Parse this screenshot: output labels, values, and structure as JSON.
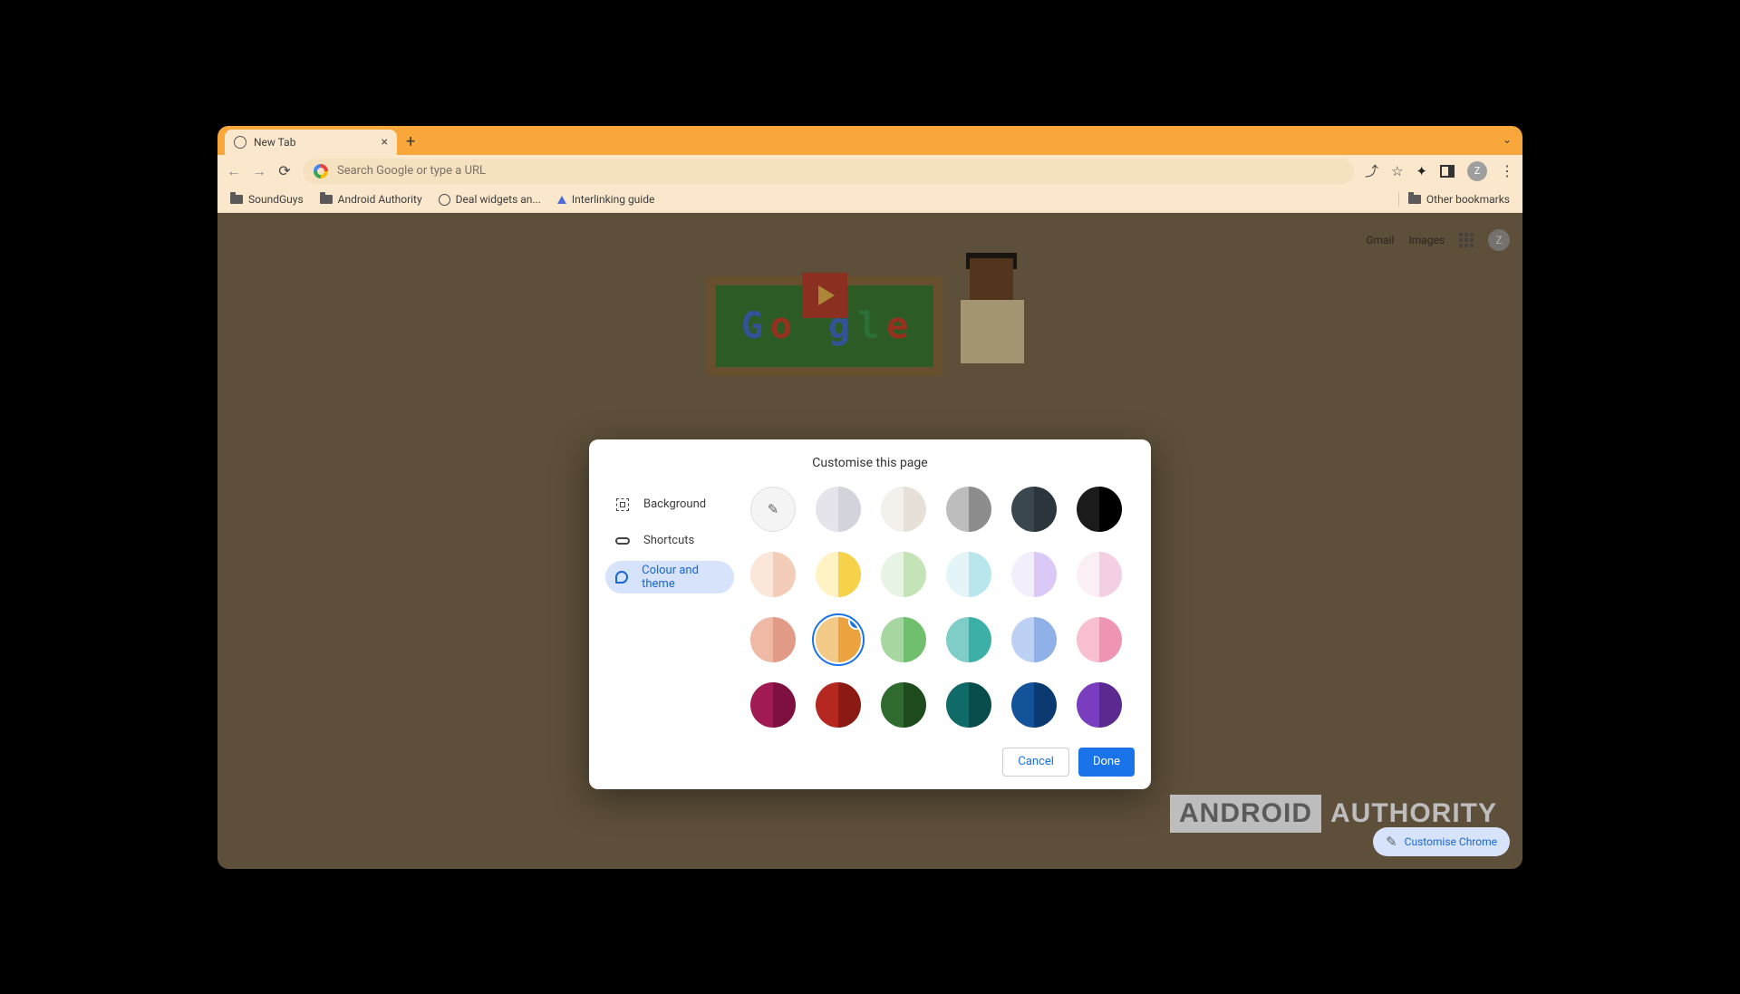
{
  "tab": {
    "title": "New Tab"
  },
  "omnibox": {
    "placeholder": "Search Google or type a URL"
  },
  "bookmarks": [
    {
      "label": "SoundGuys",
      "icon": "folder"
    },
    {
      "label": "Android Authority",
      "icon": "folder"
    },
    {
      "label": "Deal widgets an...",
      "icon": "globe"
    },
    {
      "label": "Interlinking guide",
      "icon": "drop"
    }
  ],
  "other_bookmarks_label": "Other bookmarks",
  "top_links": {
    "gmail": "Gmail",
    "images": "Images"
  },
  "avatar_letter": "Z",
  "dialog": {
    "title": "Customise this page",
    "sidebar": [
      {
        "key": "background",
        "label": "Background"
      },
      {
        "key": "shortcuts",
        "label": "Shortcuts"
      },
      {
        "key": "colour",
        "label": "Colour and theme"
      }
    ],
    "active_sidebar": "colour",
    "selected_swatch_index": 13,
    "swatches": [
      {
        "type": "custom"
      },
      {
        "l": "#e4e4ea",
        "r": "#d3d3dc"
      },
      {
        "l": "#f4f1ed",
        "r": "#e6e0d8"
      },
      {
        "l": "#bdbdbd",
        "r": "#8d8d8d"
      },
      {
        "l": "#3a474e",
        "r": "#2b363c"
      },
      {
        "l": "#1b1b1b",
        "r": "#000000"
      },
      {
        "l": "#fbe6da",
        "r": "#f3cdb7"
      },
      {
        "l": "#fff3c4",
        "r": "#f7d14a"
      },
      {
        "l": "#e8f4e3",
        "r": "#c4e4b8"
      },
      {
        "l": "#e3f5f6",
        "r": "#b7e7ec"
      },
      {
        "l": "#f3eefc",
        "r": "#dac8f6"
      },
      {
        "l": "#fceef5",
        "r": "#f4cee2"
      },
      {
        "l": "#efb9a6",
        "r": "#e29b87"
      },
      {
        "l": "#f3c988",
        "r": "#eca23f"
      },
      {
        "l": "#a6d7a1",
        "r": "#6fbf6d"
      },
      {
        "l": "#7ecdc6",
        "r": "#3cb0a6"
      },
      {
        "l": "#bcd1f3",
        "r": "#8fb1e8"
      },
      {
        "l": "#f7bfd0",
        "r": "#f094b3"
      },
      {
        "l": "#a21a54",
        "r": "#7d103f"
      },
      {
        "l": "#b42820",
        "r": "#8b1a14"
      },
      {
        "l": "#2f6a2e",
        "r": "#1e4b1e"
      },
      {
        "l": "#0f6a68",
        "r": "#084d4b"
      },
      {
        "l": "#12539a",
        "r": "#0b3a70"
      },
      {
        "l": "#7a3dbf",
        "r": "#5a2a91"
      }
    ],
    "actions": {
      "cancel": "Cancel",
      "done": "Done"
    }
  },
  "customise_button": "Customise Chrome",
  "watermark": {
    "boxed": "ANDROID",
    "light": "AUTHORITY"
  }
}
